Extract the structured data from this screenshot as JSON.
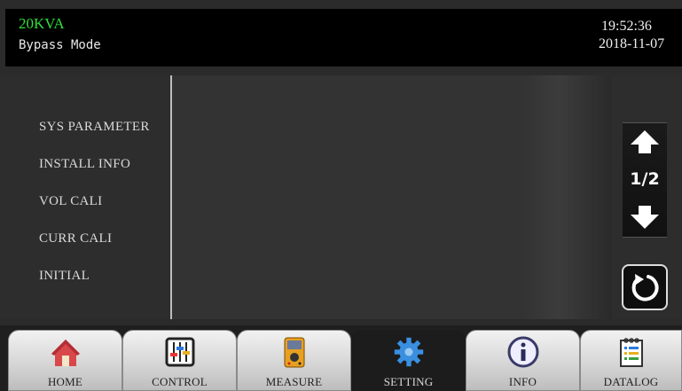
{
  "header": {
    "model": "20KVA",
    "mode": "Bypass Mode",
    "time": "19:52:36",
    "date": "2018-11-07"
  },
  "menu": {
    "items": [
      {
        "label": "SYS PARAMETER"
      },
      {
        "label": "INSTALL INFO"
      },
      {
        "label": "VOL CALI"
      },
      {
        "label": "CURR CALI"
      },
      {
        "label": "INITIAL"
      }
    ]
  },
  "pager": {
    "indicator": "1/2",
    "up_icon": "arrow-up-icon",
    "down_icon": "arrow-down-icon",
    "refresh_icon": "refresh-icon"
  },
  "tabs": [
    {
      "label": "HOME",
      "icon": "home-icon"
    },
    {
      "label": "CONTROL",
      "icon": "control-sliders-icon"
    },
    {
      "label": "MEASURE",
      "icon": "multimeter-icon"
    },
    {
      "label": "SETTING",
      "icon": "gear-icon",
      "active": true
    },
    {
      "label": "INFO",
      "icon": "info-icon"
    },
    {
      "label": "DATALOG",
      "icon": "datalog-notepad-icon"
    }
  ],
  "colors": {
    "model_text": "#2fe03a",
    "active_tab": "#1c1c1c",
    "gear": "#3a8fe0"
  }
}
